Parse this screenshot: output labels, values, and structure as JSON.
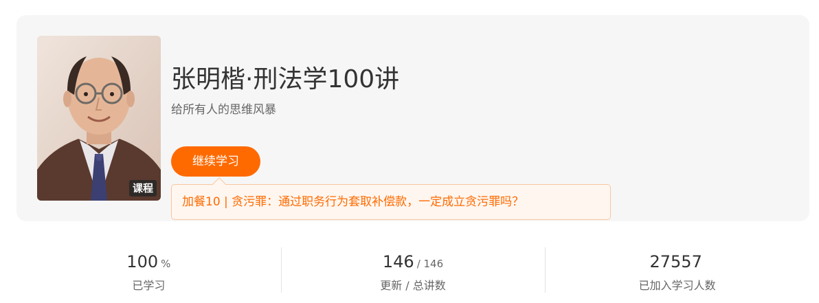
{
  "course": {
    "title": "张明楷·刑法学100讲",
    "subtitle": "给所有人的思维风暴",
    "cover_badge": "课程",
    "continue_label": "继续学习",
    "last_lesson": "加餐10 | 贪污罪：通过职务行为套取补偿款，一定成立贪污罪吗？"
  },
  "stats": [
    {
      "value": "100",
      "unit": "%",
      "label": "已学习"
    },
    {
      "value": "146",
      "unit": "/ 146",
      "label": "更新 / 总讲数"
    },
    {
      "value": "27557",
      "unit": "",
      "label": "已加入学习人数"
    }
  ],
  "colors": {
    "accent": "#ff6a00",
    "card_bg": "#f6f6f6",
    "tip_bg": "#fff6ef",
    "tip_border": "#f7c7a0"
  }
}
